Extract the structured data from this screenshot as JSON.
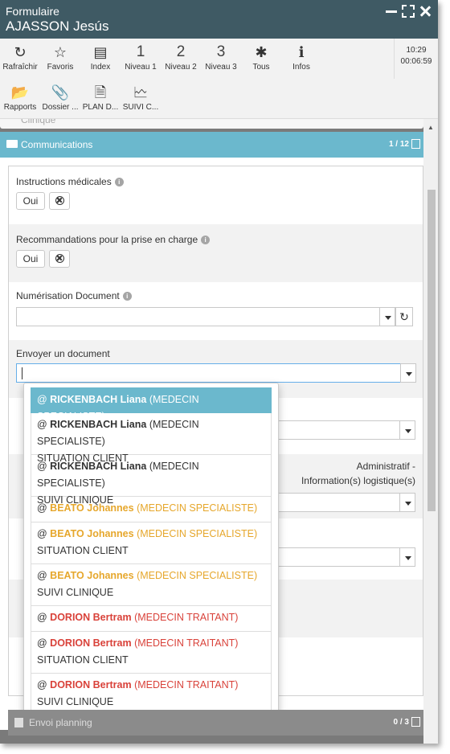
{
  "window": {
    "form_label": "Formulaire",
    "patient_name": "AJASSON Jesús"
  },
  "toolbar": {
    "row1": [
      {
        "name": "refresh",
        "icon": "refresh-icon",
        "glyph": "↻",
        "label": "Rafraîchir"
      },
      {
        "name": "favorites",
        "icon": "star-icon",
        "glyph": "☆",
        "label": "Favoris"
      },
      {
        "name": "index",
        "icon": "index-icon",
        "glyph": "▤",
        "label": "Index"
      },
      {
        "name": "level1",
        "icon": "number-icon",
        "glyph": "1",
        "label": "Niveau 1"
      },
      {
        "name": "level2",
        "icon": "number-icon",
        "glyph": "2",
        "label": "Niveau 2"
      },
      {
        "name": "level3",
        "icon": "number-icon",
        "glyph": "3",
        "label": "Niveau 3"
      },
      {
        "name": "all",
        "icon": "asterisk-icon",
        "glyph": "✱",
        "label": "Tous"
      },
      {
        "name": "infos",
        "icon": "info-icon",
        "glyph": "ℹ",
        "label": "Infos"
      }
    ],
    "row2": [
      {
        "name": "reports",
        "icon": "folder-open-icon",
        "glyph": "📂",
        "label": "Rapports"
      },
      {
        "name": "dossier",
        "icon": "paperclip-icon",
        "glyph": "📎",
        "label": "Dossier ..."
      },
      {
        "name": "plan",
        "icon": "document-icon",
        "glyph": "🗎",
        "label": "PLAN D..."
      },
      {
        "name": "suivi",
        "icon": "document-chart-icon",
        "glyph": "🗠",
        "label": "SUIVI C..."
      }
    ],
    "time": "10:29",
    "elapsed": "00:06:59"
  },
  "collapsed_section": "Clinique",
  "panel": {
    "title": "Communications",
    "count": "1 / 12"
  },
  "fields": {
    "instructions": {
      "label": "Instructions médicales",
      "yes": "Oui"
    },
    "recommandations": {
      "label": "Recommandations pour la prise en charge",
      "yes": "Oui"
    },
    "numerisation": {
      "label": "Numérisation Document"
    },
    "envoyer": {
      "label": "Envoyer un document"
    }
  },
  "right_note": {
    "line1": "Administratif -",
    "line2": "Information(s) logistique(s)"
  },
  "dropdown_options": [
    {
      "name": "RICKENBACH Liana",
      "role": "(MEDECIN SPECIALISTE)",
      "sub": "",
      "color": "active"
    },
    {
      "name": "RICKENBACH Liana",
      "role": "(MEDECIN SPECIALISTE)",
      "sub": "SITUATION CLIENT",
      "color": "normal"
    },
    {
      "name": "RICKENBACH Liana",
      "role": "(MEDECIN SPECIALISTE)",
      "sub": "SUIVI CLINIQUE",
      "color": "normal"
    },
    {
      "name": "BEATO Johannes",
      "role": "(MEDECIN SPECIALISTE)",
      "sub": "",
      "color": "yellow"
    },
    {
      "name": "BEATO Johannes",
      "role": "(MEDECIN SPECIALISTE)",
      "sub": "SITUATION CLIENT",
      "color": "yellow"
    },
    {
      "name": "BEATO Johannes",
      "role": "(MEDECIN SPECIALISTE)",
      "sub": "SUIVI CLINIQUE",
      "color": "yellow"
    },
    {
      "name": "DORION Bertram",
      "role": "(MEDECIN TRAITANT)",
      "sub": "",
      "color": "red"
    },
    {
      "name": "DORION Bertram",
      "role": "(MEDECIN TRAITANT)",
      "sub": "SITUATION CLIENT",
      "color": "red"
    },
    {
      "name": "DORION Bertram",
      "role": "(MEDECIN TRAITANT)",
      "sub": "SUIVI CLINIQUE",
      "color": "red"
    }
  ],
  "bottom_panel": {
    "title": "Envoi planning",
    "count": "0 / 3"
  },
  "colors": {
    "accent": "#6bb8cd",
    "titlebar": "#3f5a64",
    "yellow": "#e6a72c",
    "red": "#d9423a"
  }
}
